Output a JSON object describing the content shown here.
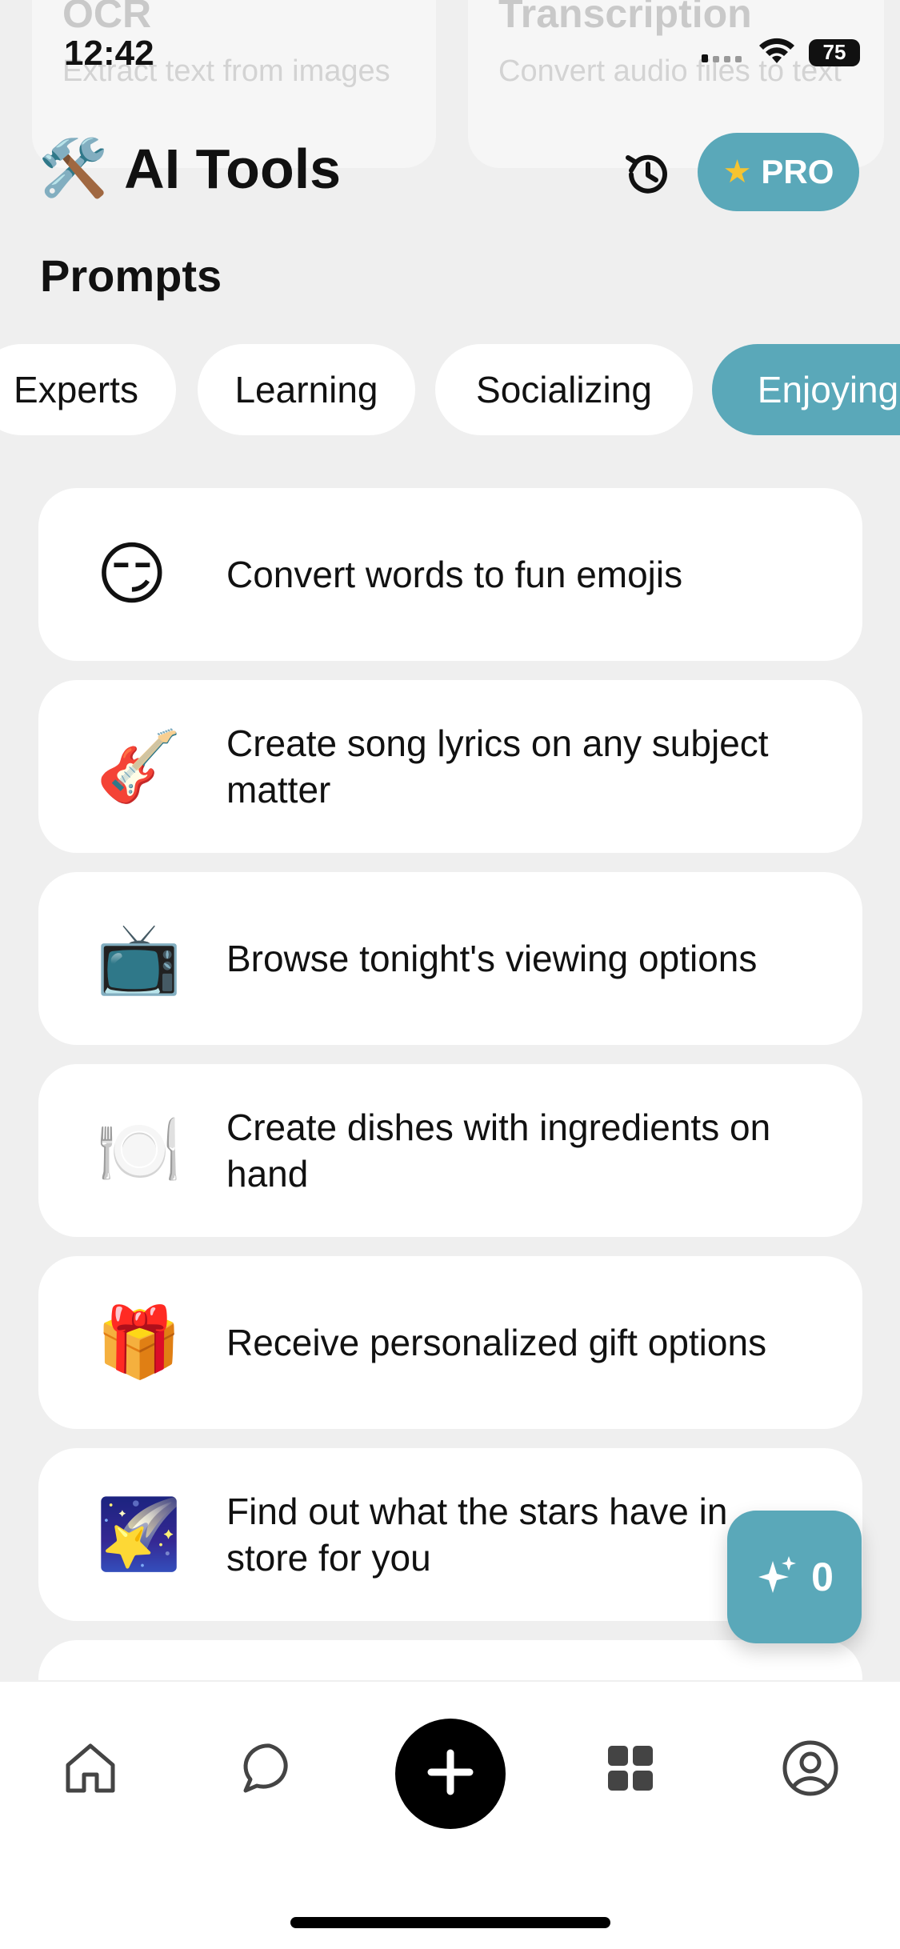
{
  "status_bar": {
    "time": "12:42",
    "battery": "75"
  },
  "background_tools": [
    {
      "title": "OCR",
      "description": "Extract text from images"
    },
    {
      "title": "Transcription",
      "description": "Convert audio files to text"
    }
  ],
  "header": {
    "emoji": "🛠️",
    "title": "AI Tools",
    "pro_label": "PRO"
  },
  "section": {
    "title": "Prompts"
  },
  "chips": [
    {
      "label": "Experts",
      "active": false
    },
    {
      "label": "Learning",
      "active": false
    },
    {
      "label": "Socializing",
      "active": false
    },
    {
      "label": "Enjoying",
      "active": true
    }
  ],
  "prompts": [
    {
      "emoji": "😏",
      "text": "Convert words to fun emojis"
    },
    {
      "emoji": "🎸",
      "text": "Create song lyrics on any subject matter"
    },
    {
      "emoji": "📺",
      "text": "Browse tonight's viewing options"
    },
    {
      "emoji": "🍽️",
      "text": "Create dishes with ingredients on hand"
    },
    {
      "emoji": "🎁",
      "text": "Receive personalized gift options"
    },
    {
      "emoji": "🌠",
      "text": "Find out what the stars have in store for you"
    }
  ],
  "credits": {
    "count": "0"
  },
  "colors": {
    "accent": "#5aa8b9",
    "background": "#efefef",
    "card": "#ffffff"
  }
}
